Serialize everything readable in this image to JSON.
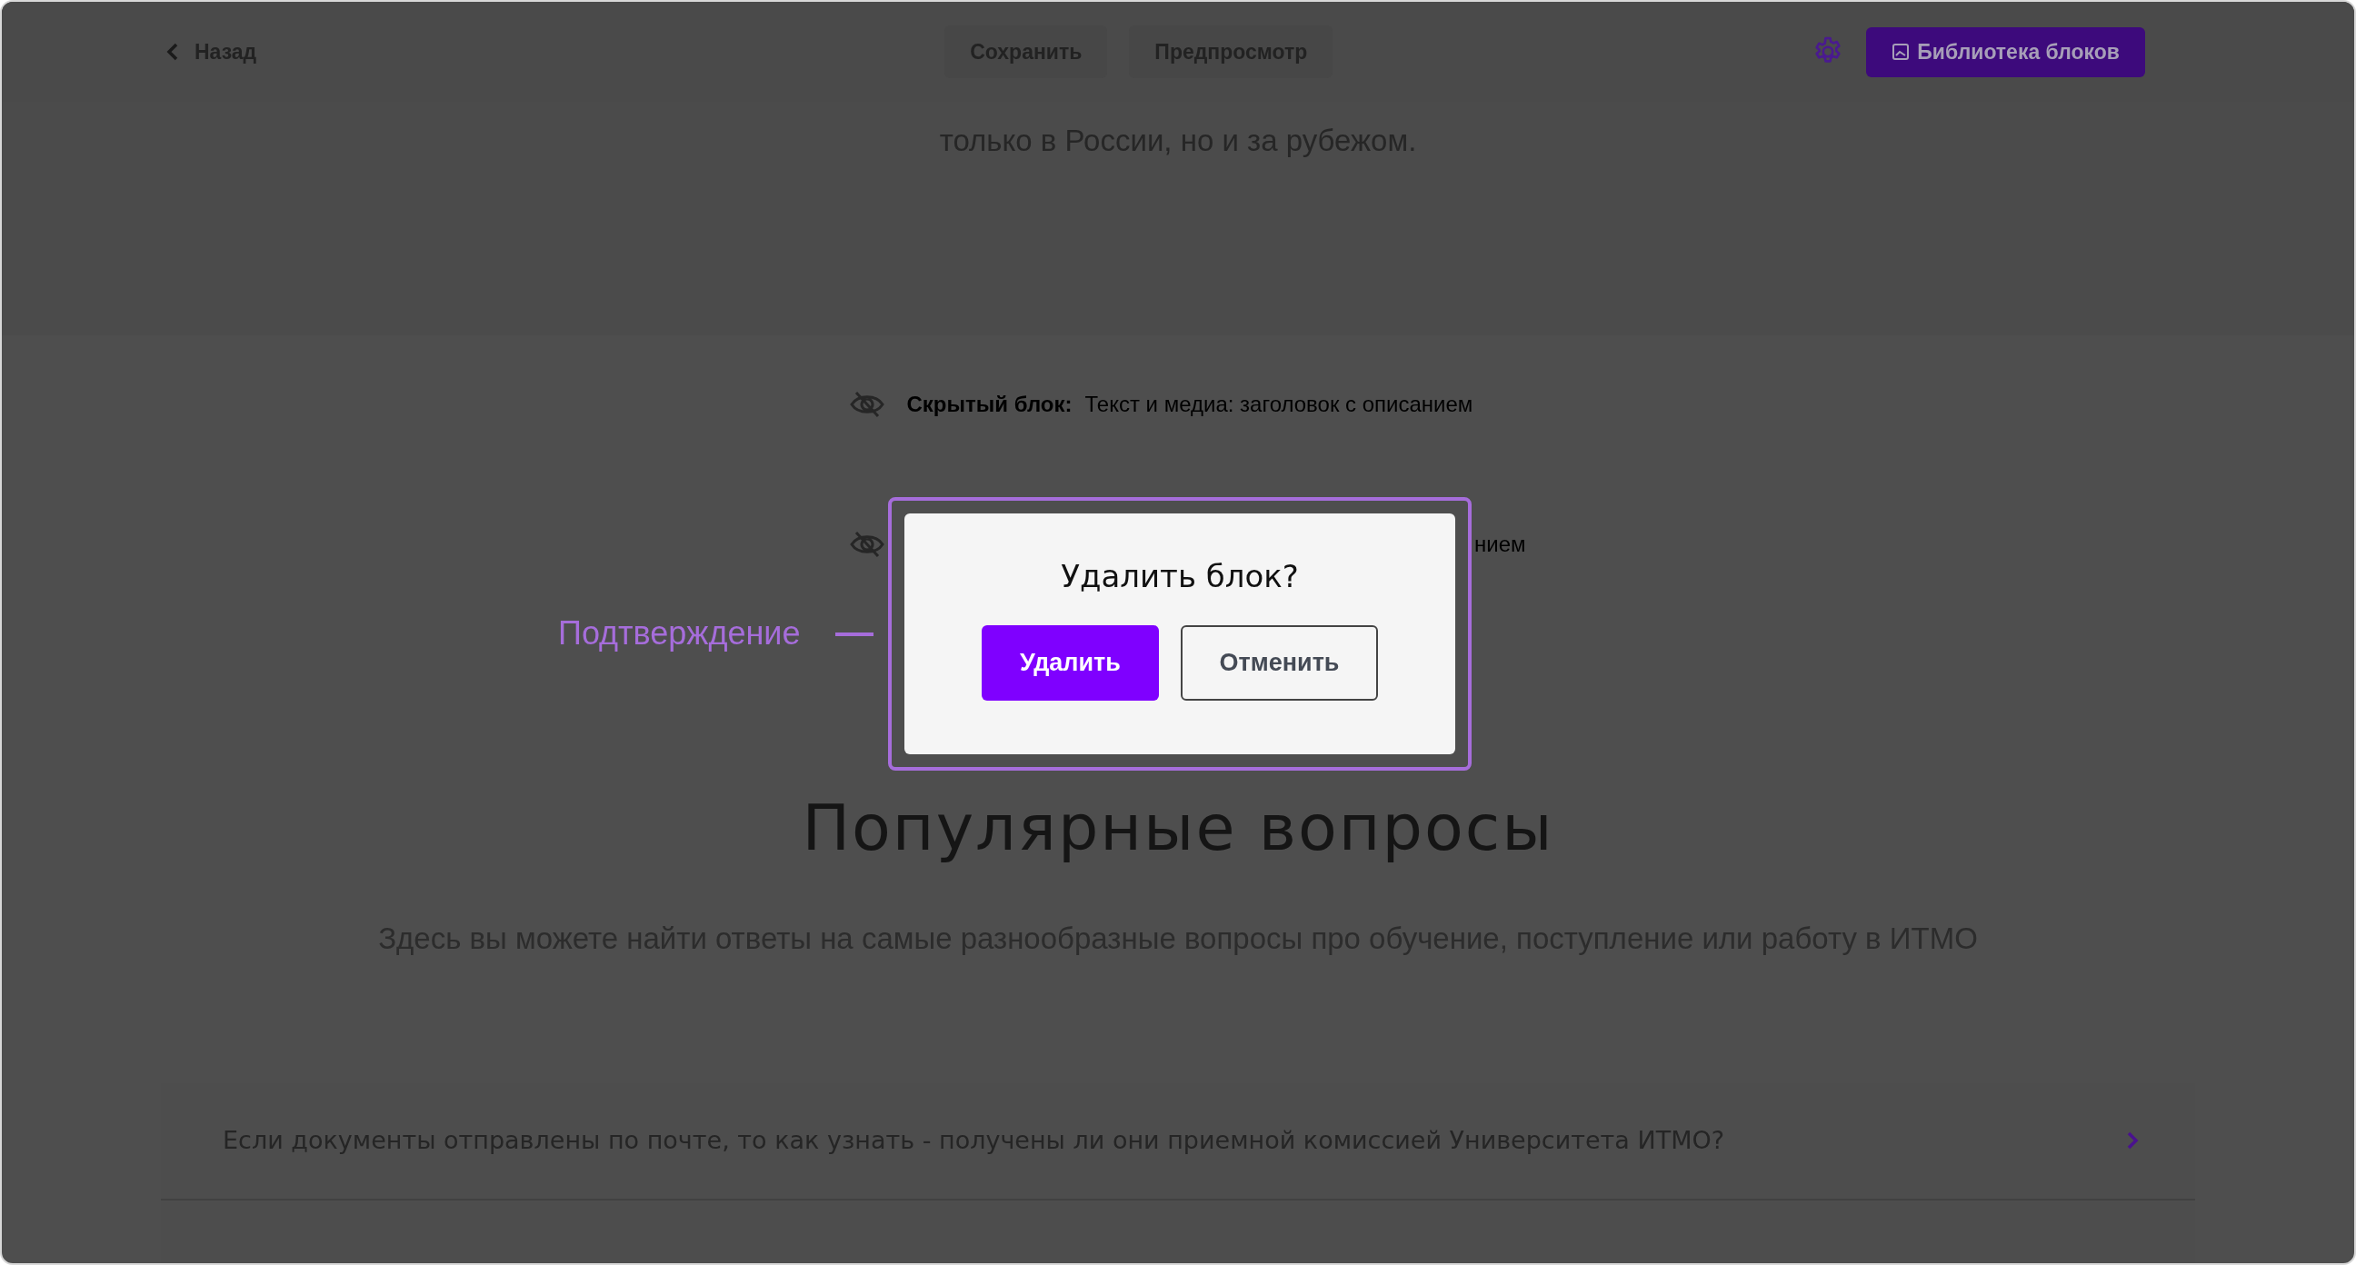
{
  "header": {
    "back": "Назад",
    "actions": [
      {
        "label": "Сохранить"
      },
      {
        "label": "Предпросмотр"
      }
    ],
    "library_button": "Библиотека блоков"
  },
  "intro": {
    "text": "только в России, но и за рубежом."
  },
  "hidden_blocks": [
    {
      "label": "Скрытый блок:",
      "description": "Текст и медиа: заголовок с описанием"
    },
    {
      "description": "нием"
    }
  ],
  "dialog": {
    "annotation": "Подтверждение",
    "title": "Удалить блок?",
    "buttons": [
      {
        "label": "Удалить",
        "kind": "primary"
      },
      {
        "label": "Отменить",
        "kind": "secondary"
      }
    ]
  },
  "faq": {
    "title": "Популярные вопросы",
    "subtitle": "Здесь вы можете найти ответы на самые разнообразные вопросы про обучение, поступление или работу в ИТМО",
    "items": [
      {
        "question": "Если документы отправлены по почте, то как узнать - получены ли они приемной комиссией Университета ИТМО?"
      }
    ]
  }
}
